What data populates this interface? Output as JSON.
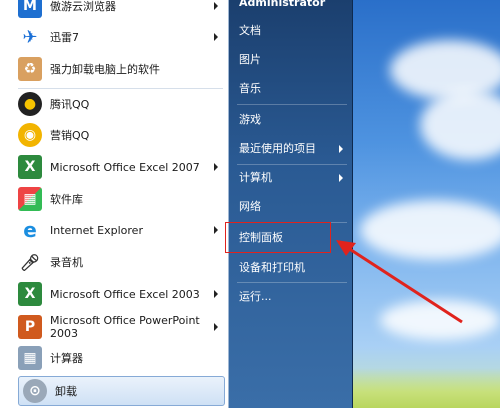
{
  "left_menu": {
    "items": [
      {
        "label": "傲游云浏览器",
        "icon": "maxthon-browser-icon",
        "has_submenu": true
      },
      {
        "label": "迅雷7",
        "icon": "xunlei-icon",
        "has_submenu": true
      },
      {
        "label": "强力卸载电脑上的软件",
        "icon": "uninstaller-box-icon",
        "has_submenu": false
      },
      {
        "label": "腾讯QQ",
        "icon": "qq-penguin-icon",
        "has_submenu": false
      },
      {
        "label": "营销QQ",
        "icon": "marketing-qq-icon",
        "has_submenu": false
      },
      {
        "label": "Microsoft Office Excel 2007",
        "icon": "excel-icon",
        "has_submenu": true
      },
      {
        "label": "软件库",
        "icon": "software-library-icon",
        "has_submenu": false
      },
      {
        "label": "Internet Explorer",
        "icon": "internet-explorer-icon",
        "has_submenu": true
      },
      {
        "label": "录音机",
        "icon": "microphone-icon",
        "has_submenu": false
      },
      {
        "label": "Microsoft Office Excel 2003",
        "icon": "excel-icon",
        "has_submenu": true
      },
      {
        "label": "Microsoft Office PowerPoint 2003",
        "icon": "powerpoint-icon",
        "has_submenu": true
      },
      {
        "label": "计算器",
        "icon": "calculator-icon",
        "has_submenu": false
      }
    ],
    "uninstall": {
      "label": "卸载",
      "icon": "uninstall-icon"
    }
  },
  "right_menu": {
    "user": "Administrator",
    "items": [
      {
        "label": "文档",
        "has_submenu": false
      },
      {
        "label": "图片",
        "has_submenu": false
      },
      {
        "label": "音乐",
        "has_submenu": false
      },
      {
        "label": "游戏",
        "has_submenu": false
      },
      {
        "label": "最近使用的项目",
        "has_submenu": true
      },
      {
        "label": "计算机",
        "has_submenu": true
      },
      {
        "label": "网络",
        "has_submenu": false
      },
      {
        "label": "控制面板",
        "has_submenu": false,
        "highlighted": true
      },
      {
        "label": "设备和打印机",
        "has_submenu": false
      },
      {
        "label": "运行...",
        "has_submenu": false
      }
    ]
  },
  "colors": {
    "highlight_red": "#e0231d",
    "right_pane_blue": "#2a5a93",
    "left_pane_bg": "#ffffff"
  }
}
